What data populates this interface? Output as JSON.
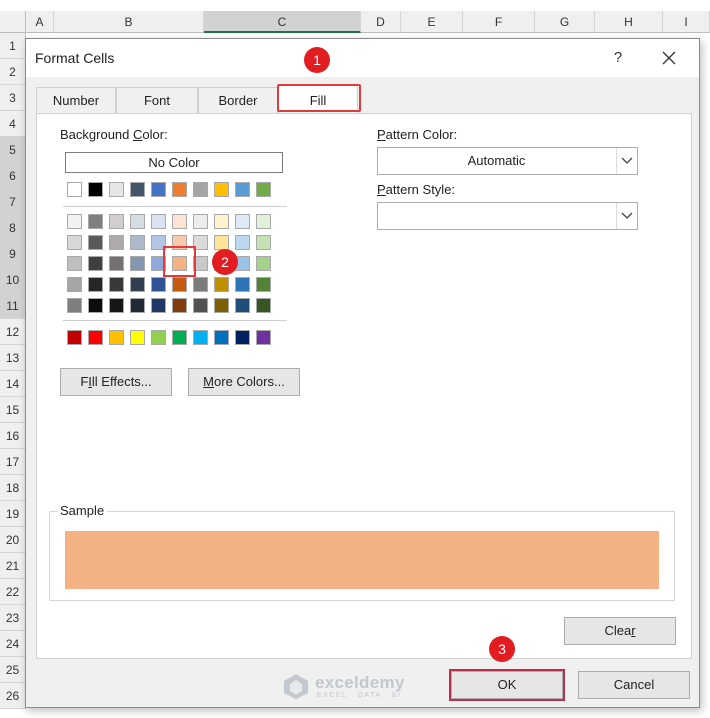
{
  "sheet": {
    "columns": [
      "A",
      "B",
      "C",
      "D",
      "E",
      "F",
      "G",
      "H",
      "I"
    ],
    "selected_column": "C",
    "rows": [
      "1",
      "2",
      "3",
      "4",
      "5",
      "6",
      "7",
      "8",
      "9",
      "10",
      "11",
      "12",
      "13",
      "14",
      "15",
      "16",
      "17",
      "18",
      "19",
      "20",
      "21",
      "22",
      "23",
      "24",
      "25",
      "26"
    ],
    "selected_rows": [
      "5",
      "6",
      "7",
      "8",
      "9",
      "10",
      "11"
    ]
  },
  "dialog": {
    "title": "Format Cells",
    "help_label": "?",
    "tabs": [
      {
        "label": "Number"
      },
      {
        "label": "Font"
      },
      {
        "label": "Border"
      },
      {
        "label": "Fill"
      }
    ],
    "active_tab": "Fill",
    "background_color_label_pre": "Background ",
    "background_color_label_key": "C",
    "background_color_label_post": "olor:",
    "no_color_label": "No Color",
    "theme_top_row": [
      "#ffffff",
      "#000000",
      "#e7e6e6",
      "#44546a",
      "#4472c4",
      "#ed7d31",
      "#a5a5a5",
      "#ffc000",
      "#5b9bd5",
      "#70ad47"
    ],
    "theme_shades": [
      [
        "#f2f2f2",
        "#7f7f7f",
        "#d0cece",
        "#d6dce4",
        "#d9e2f3",
        "#fbe4d5",
        "#ededed",
        "#fff2cc",
        "#deebf6",
        "#e2efd9"
      ],
      [
        "#d8d8d8",
        "#595959",
        "#aeaaaa",
        "#adb9ca",
        "#b4c6e7",
        "#f7caac",
        "#dbdbdb",
        "#fee599",
        "#bdd7ee",
        "#c5e0b3"
      ],
      [
        "#bfbfbf",
        "#3f3f3f",
        "#757070",
        "#8496b0",
        "#8eaadb",
        "#f4b183",
        "#c9c9c9",
        "#ffd965",
        "#9cc3e5",
        "#a8d08d"
      ],
      [
        "#a5a5a5",
        "#262626",
        "#3a3838",
        "#323f4f",
        "#2f5496",
        "#c55a11",
        "#7b7b7b",
        "#bf8f00",
        "#2e75b5",
        "#538135"
      ],
      [
        "#7f7f7f",
        "#0c0c0c",
        "#161616",
        "#222a35",
        "#1f3864",
        "#833c0b",
        "#525252",
        "#7f6000",
        "#1e4e79",
        "#375623"
      ]
    ],
    "standard_colors": [
      "#c00000",
      "#ff0000",
      "#ffc000",
      "#ffff00",
      "#92d050",
      "#00b050",
      "#00b0f0",
      "#0070c0",
      "#002060",
      "#7030a0"
    ],
    "selected_color": "#f4b183",
    "fill_effects_pre": "",
    "fill_effects_key": "I",
    "fill_effects_post": "ll Effects...",
    "fill_effects_prefix": "F",
    "more_colors_key": "M",
    "more_colors_post": "ore Colors...",
    "pattern_color_pre": "",
    "pattern_color_key": "P",
    "pattern_color_post": "attern Color:",
    "pattern_color_value": "Automatic",
    "pattern_style_key": "P",
    "pattern_style_post": "attern Style:",
    "pattern_style_value": "",
    "sample_label": "Sample",
    "sample_color": "#f4b183",
    "clear_pre": "Clea",
    "clear_key": "r",
    "ok_label": "OK",
    "cancel_label": "Cancel"
  },
  "badges": [
    "1",
    "2",
    "3"
  ],
  "badge_color": "#e21d22",
  "watermark": {
    "name": "exceldemy",
    "tagline": "EXCEL · DATA · BI"
  }
}
